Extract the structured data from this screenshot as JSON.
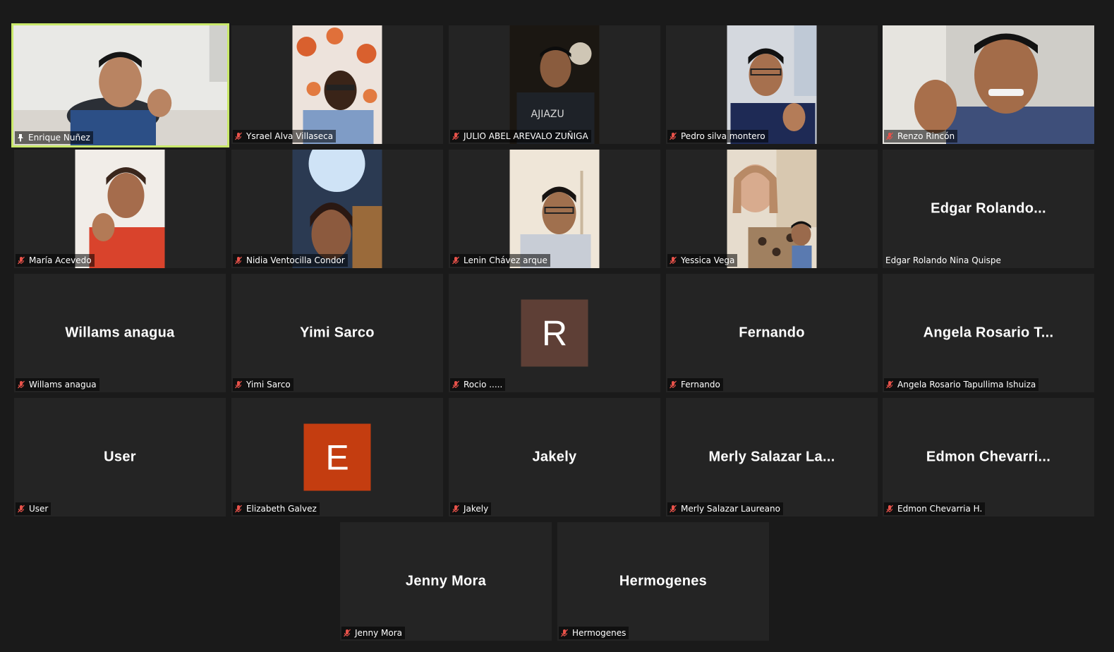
{
  "accent_active": "#c9e86a",
  "muted_icon_color": "#e8524a",
  "participants": [
    {
      "label": "Enrique Nuñez",
      "status_icon": "pin-icon",
      "video": true
    },
    {
      "label": "Ysrael Alva Villaseca",
      "status_icon": "mic-muted-icon",
      "video": true
    },
    {
      "label": "JULIO ABEL AREVALO ZUÑIGA",
      "status_icon": "mic-muted-icon",
      "video": true
    },
    {
      "label": "Pedro silva montero",
      "status_icon": "mic-muted-icon",
      "video": true
    },
    {
      "label": "Renzo Rincón",
      "status_icon": "mic-muted-icon",
      "video": true
    },
    {
      "label": "María Acevedo",
      "status_icon": "mic-muted-icon",
      "video": true
    },
    {
      "label": "Nidia Ventocilla Condor",
      "status_icon": "mic-muted-icon",
      "video": true
    },
    {
      "label": "Lenin Chávez arque",
      "status_icon": "mic-muted-icon",
      "video": true
    },
    {
      "label": "Yessica Vega",
      "status_icon": "mic-muted-icon",
      "video": true
    },
    {
      "label": "Edgar Rolando Nina Quispe",
      "center": "Edgar  Rolando...",
      "status_icon": ""
    },
    {
      "label": "Willams anagua",
      "center": "Willams anagua",
      "status_icon": "mic-muted-icon"
    },
    {
      "label": "Yimi Sarco",
      "center": "Yimi Sarco",
      "status_icon": "mic-muted-icon"
    },
    {
      "label": "Rocio .....",
      "avatar_letter": "R",
      "avatar_color": "#5e3f36",
      "status_icon": "mic-muted-icon"
    },
    {
      "label": "Fernando",
      "center": "Fernando",
      "status_icon": "mic-muted-icon"
    },
    {
      "label": "Angela Rosario Tapullima Ishuiza",
      "center": "Angela Rosario T...",
      "status_icon": "mic-muted-icon"
    },
    {
      "label": "User",
      "center": "User",
      "status_icon": "mic-muted-icon"
    },
    {
      "label": "Elizabeth Galvez",
      "avatar_letter": "E",
      "avatar_color": "#c43d10",
      "status_icon": "mic-muted-icon"
    },
    {
      "label": "Jakely",
      "center": "Jakely",
      "status_icon": "mic-muted-icon"
    },
    {
      "label": "Merly Salazar Laureano",
      "center": "Merly Salazar La...",
      "status_icon": "mic-muted-icon"
    },
    {
      "label": "Edmon Chevarria H.",
      "center": "Edmon Chevarri...",
      "status_icon": "mic-muted-icon"
    },
    {
      "label": "Jenny Mora",
      "center": "Jenny Mora",
      "status_icon": "mic-muted-icon"
    },
    {
      "label": "Hermogenes",
      "center": "Hermogenes",
      "status_icon": "mic-muted-icon"
    }
  ]
}
